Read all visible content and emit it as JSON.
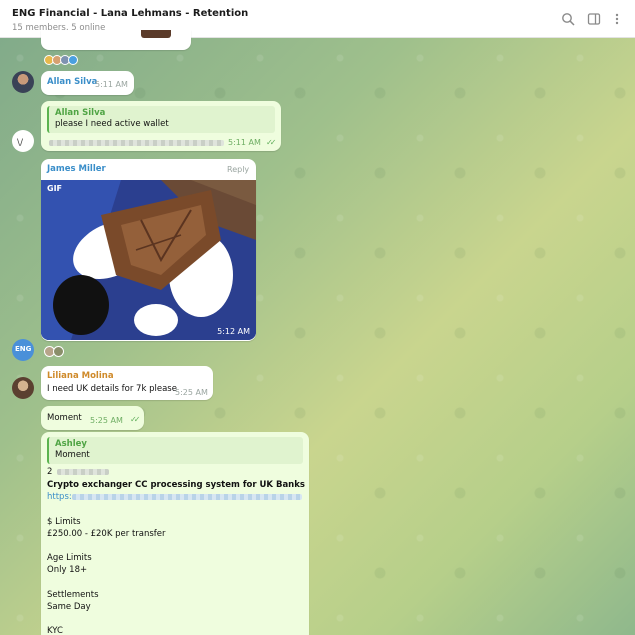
{
  "header": {
    "title": "ENG Financial - Lana Lehmans - Retention",
    "subtitle": "15 members, 5 online"
  },
  "icons": {
    "search": "search-icon",
    "panel": "sidebar-toggle-icon",
    "more": "more-vertical-icon"
  },
  "colors": {
    "accent": "#4fa444",
    "outgoing_bubble": "#effdde",
    "incoming_bubble": "#ffffff"
  },
  "messages": {
    "m1": {
      "sender": "Allan Silva",
      "time": "5:11 AM"
    },
    "m2": {
      "quote_name": "Allan Silva",
      "quote_text": "please I need active wallet",
      "time": "5:11 AM"
    },
    "m3": {
      "sender": "James Miller",
      "reply": "Reply",
      "gif_label": "GIF",
      "time": "5:12 AM"
    },
    "m4": {
      "sender": "Liliana Molina",
      "text": "I need UK details for 7k please",
      "time": "5:25 AM"
    },
    "m5": {
      "text": "Moment",
      "time": "5:25 AM"
    },
    "m6": {
      "quote_name": "Ashley",
      "quote_text": "Moment",
      "line_num": "2",
      "heading": "Crypto exchanger CC processing system for UK Banks",
      "link_prefix": "https:",
      "limits_label": "$ Limits",
      "limits_value": "£250.00 - £20K per transfer",
      "age_label": "Age Limits",
      "age_value": "Only 18+",
      "settle_label": "Settlements",
      "settle_value": "Same Day",
      "kyc_label": "KYC"
    }
  }
}
